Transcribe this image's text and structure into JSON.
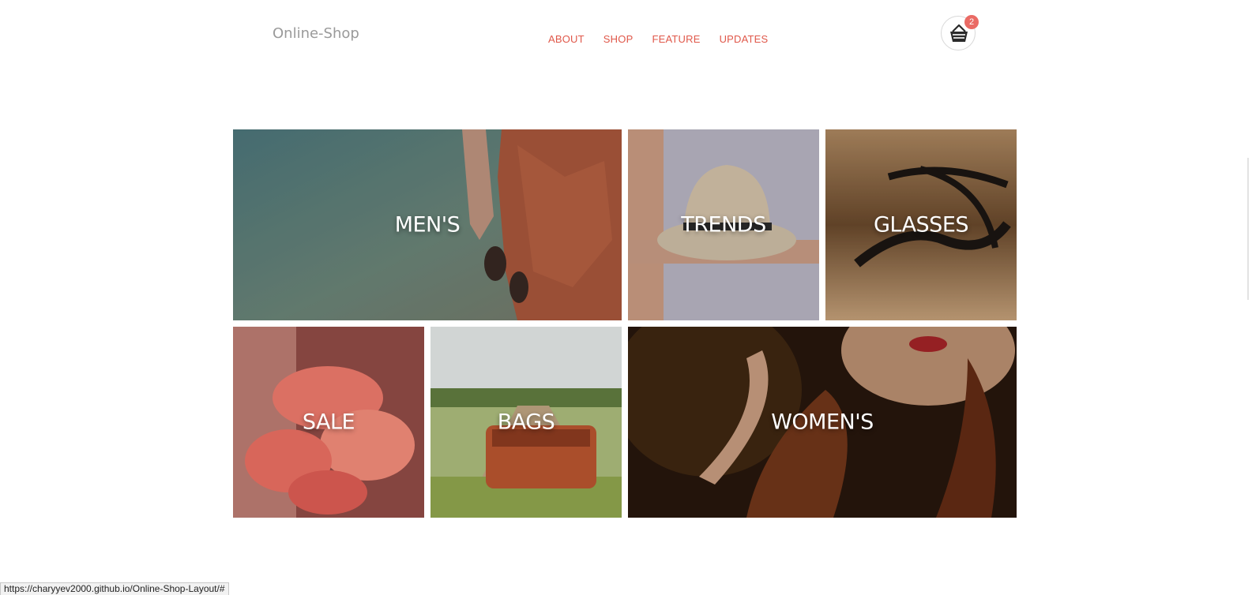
{
  "header": {
    "logo": "Online-Shop",
    "nav": [
      "ABOUT",
      "SHOP",
      "FEATURE",
      "UPDATES"
    ],
    "cart_count": "2"
  },
  "tiles": {
    "mens": "MEN'S",
    "trends": "TRENDS",
    "glasses": "GLASSES",
    "sale": "SALE",
    "bags": "BAGS",
    "womens": "WOMEN'S"
  },
  "status_url": "https://charyyev2000.github.io/Online-Shop-Layout/#",
  "colors": {
    "accent": "#e0584a",
    "badge": "#ea6a64",
    "logo": "#9a9a9a"
  }
}
